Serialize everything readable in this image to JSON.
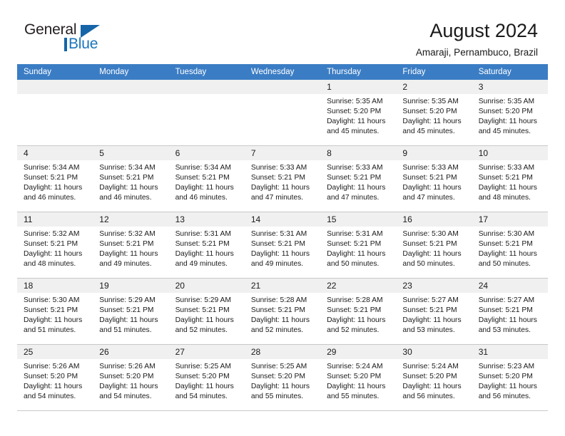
{
  "brand": {
    "name_part1": "General",
    "name_part2": "Blue",
    "accent_color": "#1b75bb"
  },
  "header": {
    "title": "August 2024",
    "subtitle": "Amaraji, Pernambuco, Brazil"
  },
  "calendar": {
    "header_bg": "#3b7dc4",
    "daynum_bg": "#f0f0f0",
    "weekday_headers": [
      "Sunday",
      "Monday",
      "Tuesday",
      "Wednesday",
      "Thursday",
      "Friday",
      "Saturday"
    ],
    "weeks": [
      [
        {
          "day": "",
          "lines": []
        },
        {
          "day": "",
          "lines": []
        },
        {
          "day": "",
          "lines": []
        },
        {
          "day": "",
          "lines": []
        },
        {
          "day": "1",
          "lines": [
            "Sunrise: 5:35 AM",
            "Sunset: 5:20 PM",
            "Daylight: 11 hours",
            "and 45 minutes."
          ]
        },
        {
          "day": "2",
          "lines": [
            "Sunrise: 5:35 AM",
            "Sunset: 5:20 PM",
            "Daylight: 11 hours",
            "and 45 minutes."
          ]
        },
        {
          "day": "3",
          "lines": [
            "Sunrise: 5:35 AM",
            "Sunset: 5:20 PM",
            "Daylight: 11 hours",
            "and 45 minutes."
          ]
        }
      ],
      [
        {
          "day": "4",
          "lines": [
            "Sunrise: 5:34 AM",
            "Sunset: 5:21 PM",
            "Daylight: 11 hours",
            "and 46 minutes."
          ]
        },
        {
          "day": "5",
          "lines": [
            "Sunrise: 5:34 AM",
            "Sunset: 5:21 PM",
            "Daylight: 11 hours",
            "and 46 minutes."
          ]
        },
        {
          "day": "6",
          "lines": [
            "Sunrise: 5:34 AM",
            "Sunset: 5:21 PM",
            "Daylight: 11 hours",
            "and 46 minutes."
          ]
        },
        {
          "day": "7",
          "lines": [
            "Sunrise: 5:33 AM",
            "Sunset: 5:21 PM",
            "Daylight: 11 hours",
            "and 47 minutes."
          ]
        },
        {
          "day": "8",
          "lines": [
            "Sunrise: 5:33 AM",
            "Sunset: 5:21 PM",
            "Daylight: 11 hours",
            "and 47 minutes."
          ]
        },
        {
          "day": "9",
          "lines": [
            "Sunrise: 5:33 AM",
            "Sunset: 5:21 PM",
            "Daylight: 11 hours",
            "and 47 minutes."
          ]
        },
        {
          "day": "10",
          "lines": [
            "Sunrise: 5:33 AM",
            "Sunset: 5:21 PM",
            "Daylight: 11 hours",
            "and 48 minutes."
          ]
        }
      ],
      [
        {
          "day": "11",
          "lines": [
            "Sunrise: 5:32 AM",
            "Sunset: 5:21 PM",
            "Daylight: 11 hours",
            "and 48 minutes."
          ]
        },
        {
          "day": "12",
          "lines": [
            "Sunrise: 5:32 AM",
            "Sunset: 5:21 PM",
            "Daylight: 11 hours",
            "and 49 minutes."
          ]
        },
        {
          "day": "13",
          "lines": [
            "Sunrise: 5:31 AM",
            "Sunset: 5:21 PM",
            "Daylight: 11 hours",
            "and 49 minutes."
          ]
        },
        {
          "day": "14",
          "lines": [
            "Sunrise: 5:31 AM",
            "Sunset: 5:21 PM",
            "Daylight: 11 hours",
            "and 49 minutes."
          ]
        },
        {
          "day": "15",
          "lines": [
            "Sunrise: 5:31 AM",
            "Sunset: 5:21 PM",
            "Daylight: 11 hours",
            "and 50 minutes."
          ]
        },
        {
          "day": "16",
          "lines": [
            "Sunrise: 5:30 AM",
            "Sunset: 5:21 PM",
            "Daylight: 11 hours",
            "and 50 minutes."
          ]
        },
        {
          "day": "17",
          "lines": [
            "Sunrise: 5:30 AM",
            "Sunset: 5:21 PM",
            "Daylight: 11 hours",
            "and 50 minutes."
          ]
        }
      ],
      [
        {
          "day": "18",
          "lines": [
            "Sunrise: 5:30 AM",
            "Sunset: 5:21 PM",
            "Daylight: 11 hours",
            "and 51 minutes."
          ]
        },
        {
          "day": "19",
          "lines": [
            "Sunrise: 5:29 AM",
            "Sunset: 5:21 PM",
            "Daylight: 11 hours",
            "and 51 minutes."
          ]
        },
        {
          "day": "20",
          "lines": [
            "Sunrise: 5:29 AM",
            "Sunset: 5:21 PM",
            "Daylight: 11 hours",
            "and 52 minutes."
          ]
        },
        {
          "day": "21",
          "lines": [
            "Sunrise: 5:28 AM",
            "Sunset: 5:21 PM",
            "Daylight: 11 hours",
            "and 52 minutes."
          ]
        },
        {
          "day": "22",
          "lines": [
            "Sunrise: 5:28 AM",
            "Sunset: 5:21 PM",
            "Daylight: 11 hours",
            "and 52 minutes."
          ]
        },
        {
          "day": "23",
          "lines": [
            "Sunrise: 5:27 AM",
            "Sunset: 5:21 PM",
            "Daylight: 11 hours",
            "and 53 minutes."
          ]
        },
        {
          "day": "24",
          "lines": [
            "Sunrise: 5:27 AM",
            "Sunset: 5:21 PM",
            "Daylight: 11 hours",
            "and 53 minutes."
          ]
        }
      ],
      [
        {
          "day": "25",
          "lines": [
            "Sunrise: 5:26 AM",
            "Sunset: 5:20 PM",
            "Daylight: 11 hours",
            "and 54 minutes."
          ]
        },
        {
          "day": "26",
          "lines": [
            "Sunrise: 5:26 AM",
            "Sunset: 5:20 PM",
            "Daylight: 11 hours",
            "and 54 minutes."
          ]
        },
        {
          "day": "27",
          "lines": [
            "Sunrise: 5:25 AM",
            "Sunset: 5:20 PM",
            "Daylight: 11 hours",
            "and 54 minutes."
          ]
        },
        {
          "day": "28",
          "lines": [
            "Sunrise: 5:25 AM",
            "Sunset: 5:20 PM",
            "Daylight: 11 hours",
            "and 55 minutes."
          ]
        },
        {
          "day": "29",
          "lines": [
            "Sunrise: 5:24 AM",
            "Sunset: 5:20 PM",
            "Daylight: 11 hours",
            "and 55 minutes."
          ]
        },
        {
          "day": "30",
          "lines": [
            "Sunrise: 5:24 AM",
            "Sunset: 5:20 PM",
            "Daylight: 11 hours",
            "and 56 minutes."
          ]
        },
        {
          "day": "31",
          "lines": [
            "Sunrise: 5:23 AM",
            "Sunset: 5:20 PM",
            "Daylight: 11 hours",
            "and 56 minutes."
          ]
        }
      ]
    ]
  }
}
